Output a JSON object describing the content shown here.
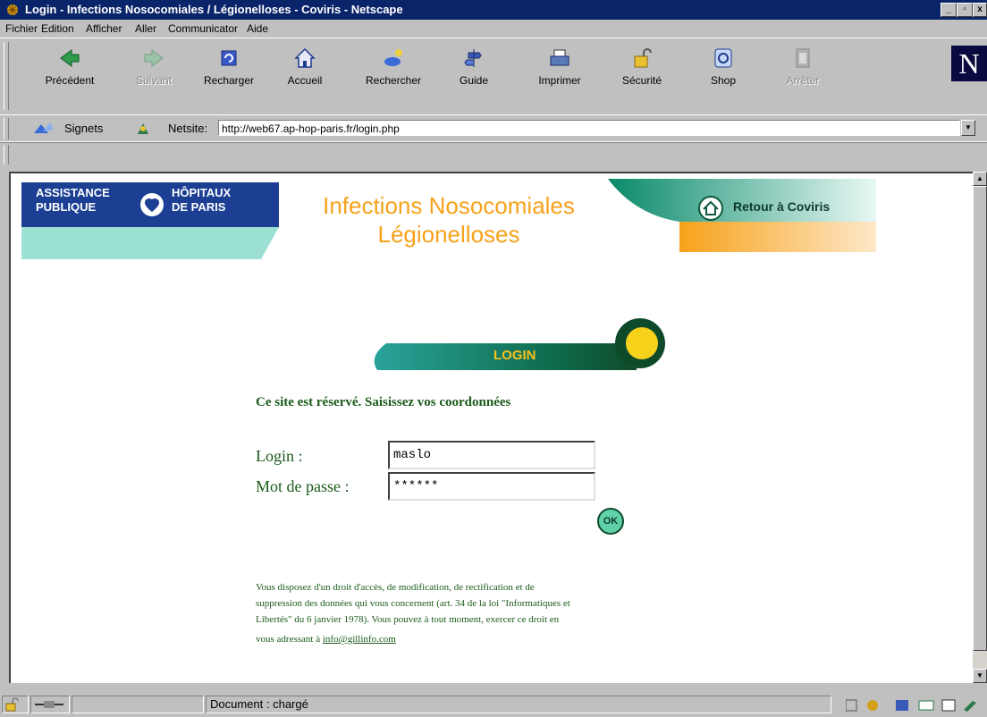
{
  "window": {
    "title": "Login - Infections Nosocomiales / Légionelloses - Coviris - Netscape",
    "min": "_",
    "max": "▫",
    "close": "x"
  },
  "menu": [
    "Fichier",
    "Edition",
    "Afficher",
    "Aller",
    "Communicator",
    "Aide"
  ],
  "toolbar": {
    "buttons": [
      {
        "label": "Précédent",
        "icon": "back-arrow-icon",
        "enabled": true
      },
      {
        "label": "Suivant",
        "icon": "forward-arrow-icon",
        "enabled": false
      },
      {
        "label": "Recharger",
        "icon": "reload-icon",
        "enabled": true
      },
      {
        "label": "Accueil",
        "icon": "home-icon",
        "enabled": true
      },
      {
        "label": "Rechercher",
        "icon": "search-icon",
        "enabled": true
      },
      {
        "label": "Guide",
        "icon": "guide-icon",
        "enabled": true
      },
      {
        "label": "Imprimer",
        "icon": "printer-icon",
        "enabled": true
      },
      {
        "label": "Sécurité",
        "icon": "lock-icon",
        "enabled": true
      },
      {
        "label": "Shop",
        "icon": "shop-icon",
        "enabled": true
      },
      {
        "label": "Arrêter",
        "icon": "stop-icon",
        "enabled": false
      }
    ],
    "logo": "N"
  },
  "location": {
    "bookmarks_label": "Signets",
    "netsite_label": "Netsite:",
    "url": "http://web67.ap-hop-paris.fr/login.php"
  },
  "page": {
    "header": {
      "org_left_1": "ASSISTANCE",
      "org_left_2": "PUBLIQUE",
      "org_right_1": "HÔPITAUX",
      "org_right_2": "DE PARIS",
      "title_line1": "Infections Nosocomiales",
      "title_line2": "Légionelloses",
      "return_link": "Retour à Coviris"
    },
    "login_banner": "LOGIN",
    "intro": "Ce site est réservé. Saisissez vos coordonnées",
    "login_label": "Login :",
    "login_value": "maslo",
    "password_label": "Mot de passe :",
    "password_value": "******",
    "ok_button": "OK",
    "notice_line1": "Vous disposez d'un droit d'accès, de modification, de rectification et de",
    "notice_line2": "suppression des données qui vous concernent (art. 34 de la loi \"Informatiques et",
    "notice_line3": "Libertés\" du 6 janvier 1978). Vous pouvez à tout moment, exercer ce droit en",
    "notice_line4_prefix": "vous adressant à ",
    "notice_email": "info@gillinfo.com"
  },
  "status": {
    "text": "Document : chargé"
  },
  "colors": {
    "ap_blue": "#1c3f94",
    "orange": "#f7a21b",
    "teal": "#2aa39a",
    "dark_green": "#0e4a2a",
    "text_green": "#1a5a1a"
  }
}
